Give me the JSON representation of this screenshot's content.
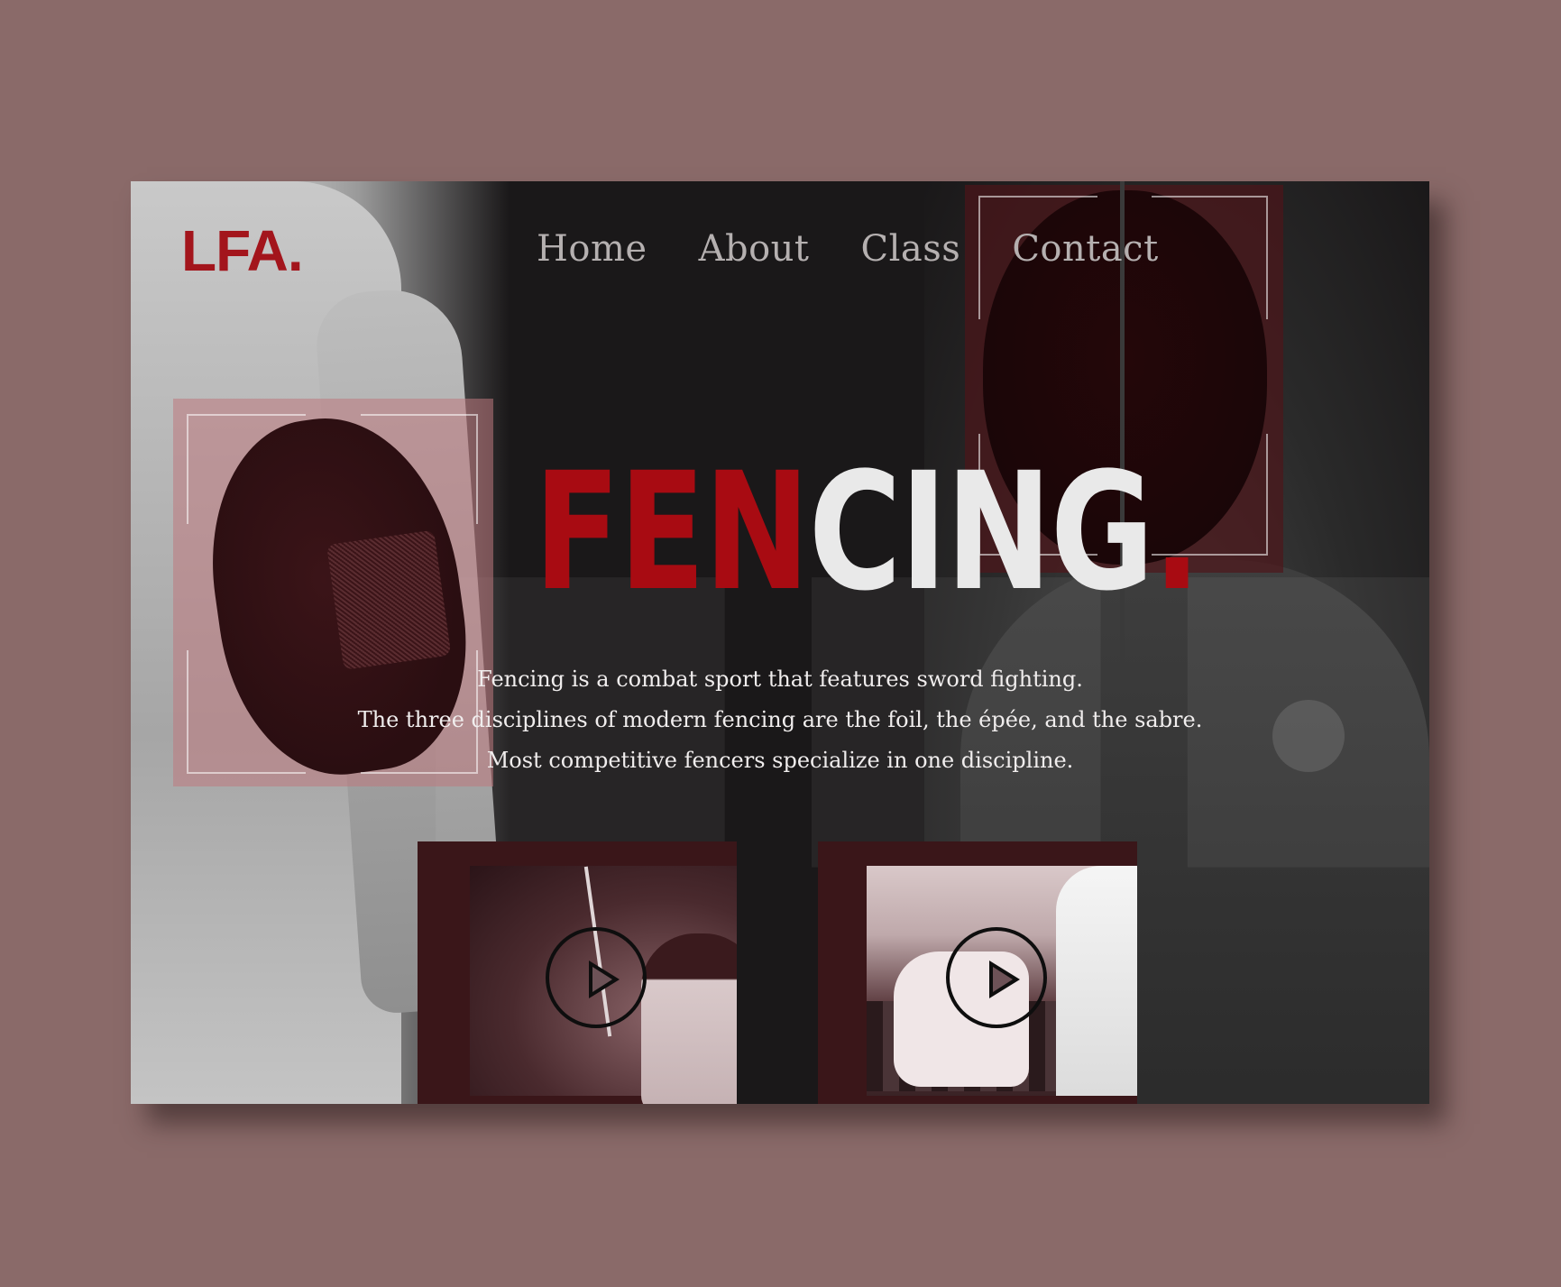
{
  "brand": {
    "logo": "LFA."
  },
  "nav": {
    "items": [
      {
        "label": "Home"
      },
      {
        "label": "About"
      },
      {
        "label": "Class"
      },
      {
        "label": "Contact"
      }
    ]
  },
  "hero": {
    "title_red": "FEN",
    "title_white": "CING",
    "title_dot": ".",
    "description": [
      "Fencing is a combat sport that features sword fighting.",
      "The three disciplines of modern fencing are the foil, the épée, and the sabre.",
      "Most competitive fencers specialize in one discipline."
    ]
  },
  "videos": [
    {
      "icon": "play-icon"
    },
    {
      "icon": "play-icon"
    }
  ],
  "colors": {
    "background": "#8a6a69",
    "panel": "#1a1819",
    "accent": "#a80b12",
    "nav_text": "#b5b0b0"
  }
}
